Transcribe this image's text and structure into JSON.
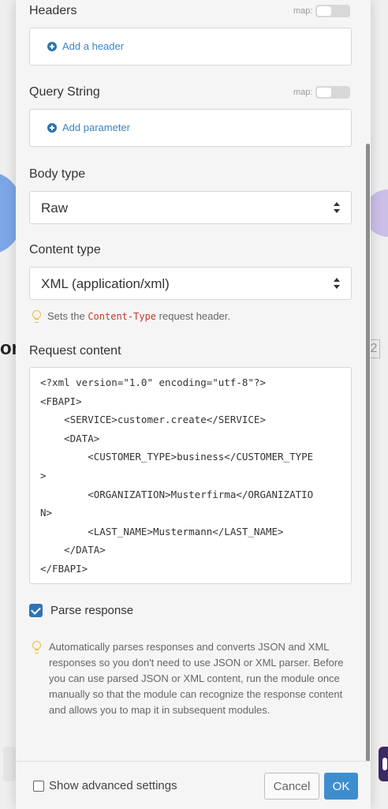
{
  "canvas": {
    "left_text": "om",
    "right_box_text": "2"
  },
  "headers": {
    "label": "Headers",
    "map_label": "map:",
    "add_label": "Add a header"
  },
  "query_string": {
    "label": "Query String",
    "map_label": "map:",
    "add_label": "Add parameter"
  },
  "body_type": {
    "label": "Body type",
    "value": "Raw"
  },
  "content_type": {
    "label": "Content type",
    "value": "XML (application/xml)",
    "hint_prefix": "Sets the",
    "hint_code": "Content-Type",
    "hint_suffix": "request header."
  },
  "request_content": {
    "label": "Request content",
    "lines": [
      "<?xml version=\"1.0\" encoding=\"utf-8\"?>",
      "<FBAPI>",
      "    <SERVICE>customer.create</SERVICE>",
      "    <DATA>",
      "        <CUSTOMER_TYPE>business</CUSTOMER_TYPE",
      ">",
      "        <ORGANIZATION>Musterfirma</ORGANIZATIO",
      "N>",
      "        <LAST_NAME>Mustermann</LAST_NAME>",
      "    </DATA>",
      "</FBAPI>"
    ]
  },
  "parse_response": {
    "label": "Parse response",
    "checked": true,
    "hint": "Automatically parses responses and converts JSON and XML responses so you don't need to use JSON or XML parser. Before you can use parsed JSON or XML content, run the module once manually so that the module can recognize the response content and allows you to map it in subsequent modules."
  },
  "footer": {
    "advanced_label": "Show advanced settings",
    "cancel_label": "Cancel",
    "ok_label": "OK"
  },
  "colors": {
    "accent": "#3e8ecf",
    "link": "#3a84c4",
    "code_token": "#c0392b",
    "bulb": "#f2bf3a"
  }
}
